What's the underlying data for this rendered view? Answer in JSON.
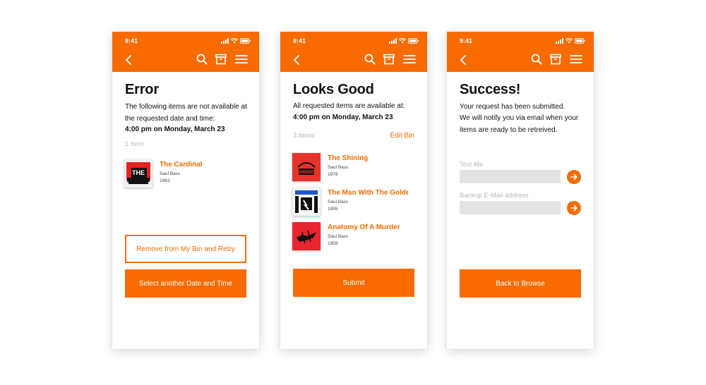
{
  "status_time": "9:41",
  "colors": {
    "accent": "#f76b00",
    "muted": "#b9b9b9",
    "field_bg": "#e3e3e3"
  },
  "icons": [
    "back-chevron-icon",
    "search-icon",
    "archive-box-icon",
    "hamburger-menu-icon",
    "arrow-right-icon"
  ],
  "error_screen": {
    "title": "Error",
    "message": "The following items are not available at the requested date and time:",
    "datetime": "4:00 pm on Monday, March 23",
    "count": "1 Item",
    "items": [
      {
        "title": "The Cardinal",
        "author": "Saul Bass",
        "year": "1963",
        "poster_text": "THE CARDINAL"
      }
    ],
    "remove_button": "Remove from My Bin and Retry",
    "select_button": "Select another Date and Time"
  },
  "good_screen": {
    "title": "Looks Good",
    "message": "All requested items are available at:",
    "datetime": "4:00 pm on Monday, March 23",
    "count": "3 items",
    "edit_link": "Edit Bin",
    "items": [
      {
        "title": "The Shining",
        "author": "Saul Bass",
        "year": "1978",
        "poster_text": "THE SHINING"
      },
      {
        "title": "The Man With The Golden Arm",
        "author": "Saul Bass",
        "year": "1955"
      },
      {
        "title": "Anatomy Of A Murder",
        "author": "Saul Bass",
        "year": "1959"
      }
    ],
    "submit_button": "Submit"
  },
  "success_screen": {
    "title": "Success!",
    "message_line1": "Your request has been submitted.",
    "message_line2": "We will notify you via email when your items are ready to be retreived.",
    "text_me_placeholder": "Text Me",
    "email_placeholder": "Backup E-Mail address",
    "back_button": "Back to Browse"
  }
}
